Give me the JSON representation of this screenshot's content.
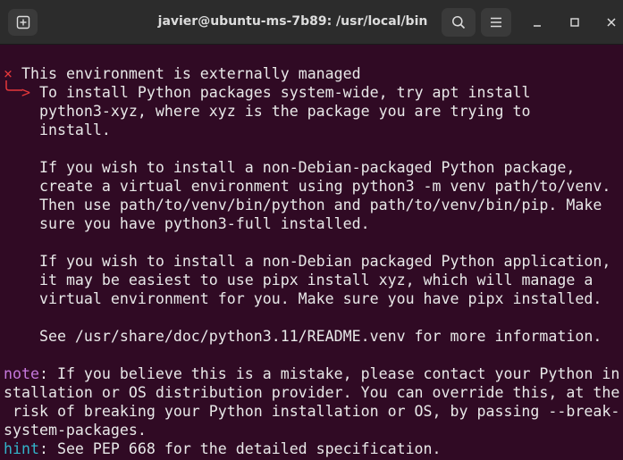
{
  "window": {
    "title": "javier@ubuntu-ms-7b89: /usr/local/bin"
  },
  "titlebar": {
    "new_tab_icon": "new-tab-icon",
    "search_icon": "search-icon",
    "menu_icon": "hamburger-menu-icon",
    "minimize_icon": "minimize-icon",
    "maximize_icon": "maximize-icon",
    "close_icon": "close-icon"
  },
  "terminal": {
    "error_marker": "×",
    "error_title": "This environment is externally managed",
    "arrow": ">",
    "message_lines": [
      "To install Python packages system-wide, try apt install",
      "python3-xyz, where xyz is the package you are trying to",
      "install.",
      "",
      "If you wish to install a non-Debian-packaged Python package,",
      "create a virtual environment using python3 -m venv path/to/venv.",
      "Then use path/to/venv/bin/python and path/to/venv/bin/pip. Make",
      "sure you have python3-full installed.",
      "",
      "If you wish to install a non-Debian packaged Python application,",
      "it may be easiest to use pipx install xyz, which will manage a",
      "virtual environment for you. Make sure you have pipx installed.",
      "",
      "See /usr/share/doc/python3.11/README.venv for more information."
    ],
    "note_label": "note",
    "note_lines": [
      ": If you believe this is a mistake, please contact your Python in",
      "stallation or OS distribution provider. You can override this, at the",
      " risk of breaking your Python installation or OS, by passing --break-",
      "system-packages."
    ],
    "hint_label": "hint",
    "hint_text": ": See PEP 668 for the detailed specification."
  },
  "colors": {
    "background": "#300a24",
    "titlebar": "#2c2c2c",
    "error_red": "#e5383b",
    "note_purple": "#c678dd",
    "hint_cyan": "#32b3c9",
    "text": "#e8e8e8"
  }
}
